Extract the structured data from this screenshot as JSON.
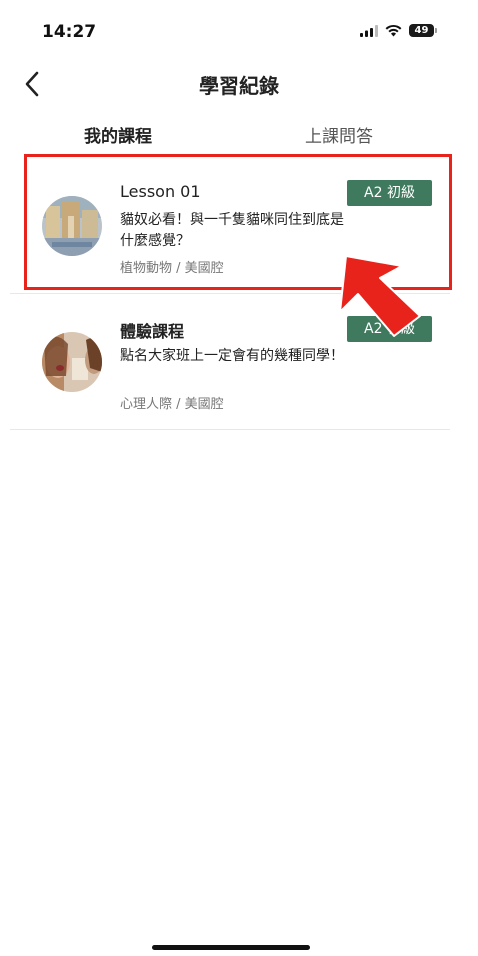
{
  "status_bar": {
    "time": "14:27",
    "battery": "49",
    "icons": [
      "signal-icon",
      "wifi-icon",
      "battery-icon"
    ]
  },
  "nav": {
    "back_icon": "chevron-left-icon",
    "title": "學習紀錄"
  },
  "tabs": [
    {
      "label": "我的課程",
      "active": true
    },
    {
      "label": "上課問答",
      "active": false
    }
  ],
  "courses": [
    {
      "title": "Lesson 01",
      "description": "貓奴必看！與一千隻貓咪同住到底是什麼感覺？",
      "meta": "植物動物 / 美國腔",
      "level": "A2 初級",
      "highlighted": true
    },
    {
      "title": "體驗課程",
      "description": "點名大家班上一定會有的幾種同學！",
      "meta": "心理人際 / 美國腔",
      "level": "A2 初級",
      "highlighted": false
    }
  ],
  "colors": {
    "badge": "#3f7a5f",
    "highlight": "#e8231c"
  }
}
